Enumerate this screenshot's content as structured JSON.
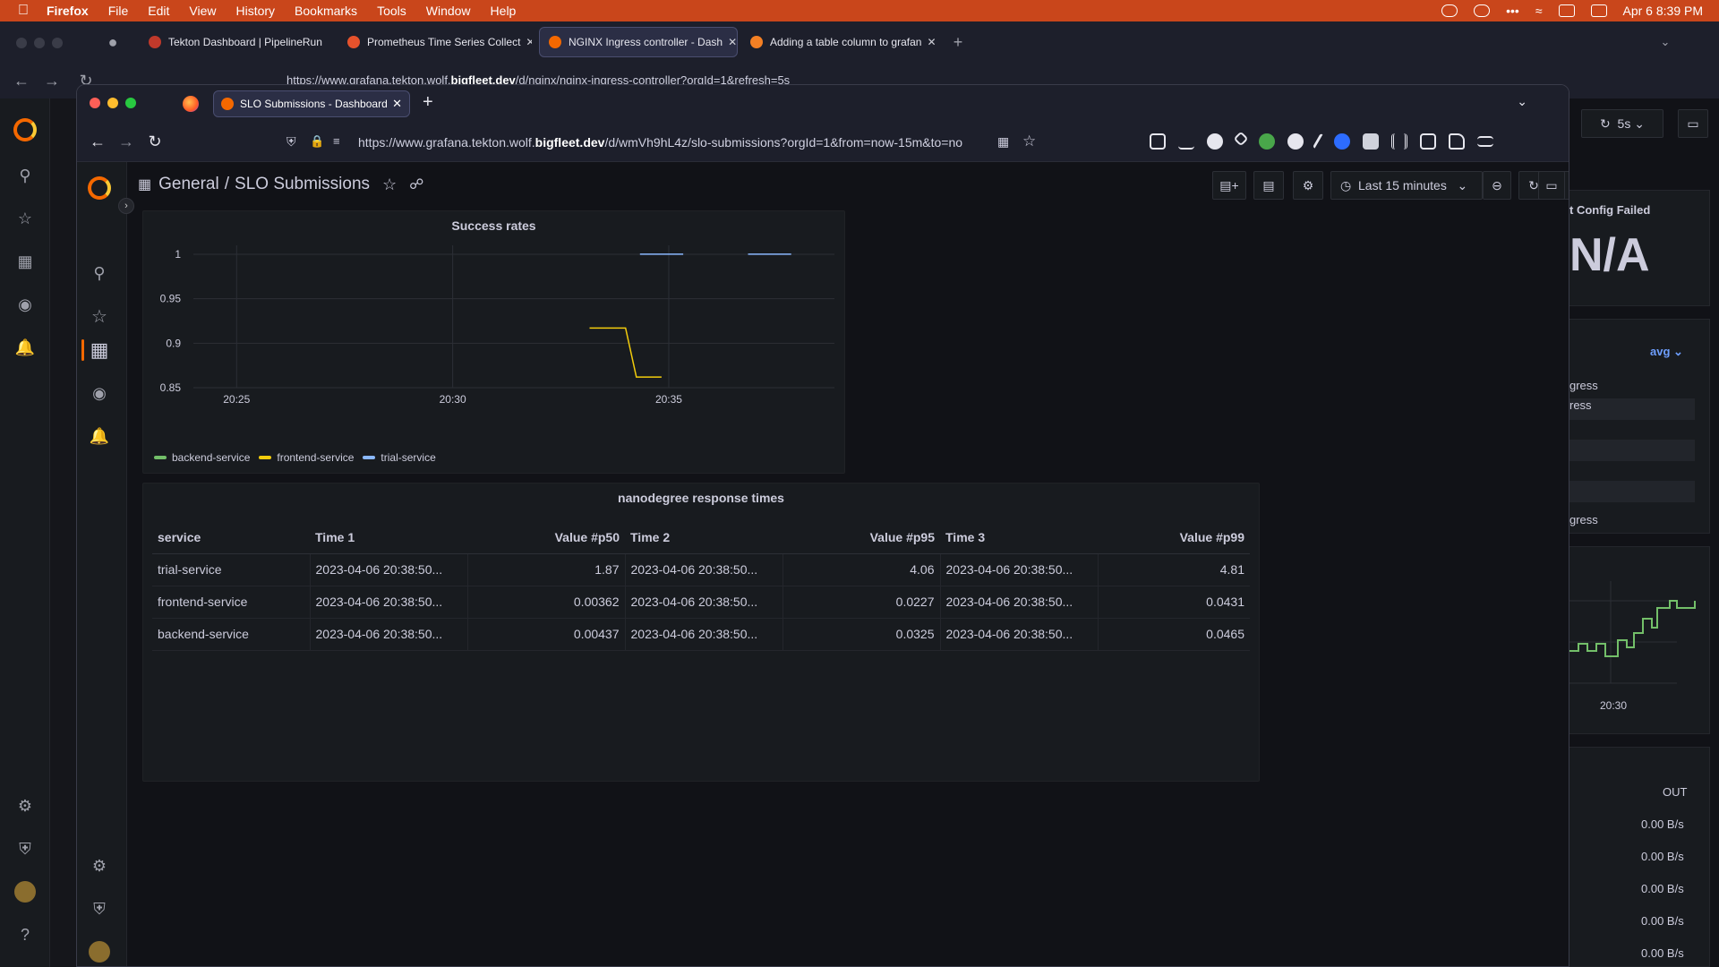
{
  "menubar": {
    "app": "Firefox",
    "items": [
      "File",
      "Edit",
      "View",
      "History",
      "Bookmarks",
      "Tools",
      "Window",
      "Help"
    ],
    "datetime": "Apr 6  8:39 PM"
  },
  "bg_window": {
    "tabs": [
      {
        "label": "Tekton Dashboard | PipelineRun"
      },
      {
        "label": "Prometheus Time Series Collect"
      },
      {
        "label": "NGINX Ingress controller - Dash"
      },
      {
        "label": "Adding a table column to grafan"
      }
    ],
    "url_prefix": "https://www.grafana.tekton.wolf.",
    "url_domain": "bigfleet.dev",
    "url_suffix": "/d/nginx/nginx-ingress-controller?orgId=1&refresh=5s",
    "refresh_interval": "5s",
    "stat_title": "t Config Failed",
    "stat_value": "N/A",
    "avg_label": "avg",
    "row_labels": [
      "gress",
      "ress",
      "gress"
    ],
    "chart_tick": "20:30",
    "out_header": "OUT",
    "out_values": [
      "0.00 B/s",
      "0.00 B/s",
      "0.00 B/s",
      "0.00 B/s",
      "0.00 B/s"
    ]
  },
  "window": {
    "tab_title": "SLO Submissions - Dashboards",
    "url_prefix": "https://www.grafana.tekton.wolf.",
    "url_domain": "bigfleet.dev",
    "url_suffix": "/d/wmVh9hL4z/slo-submissions?orgId=1&from=now-15m&to=no"
  },
  "dashboard": {
    "folder": "General",
    "title": "SLO Submissions",
    "time_range": "Last 15 minutes"
  },
  "chart_data": {
    "type": "line",
    "title": "Success rates",
    "xlabel": "",
    "ylabel": "",
    "x_ticks": [
      "20:25",
      "20:30",
      "20:35"
    ],
    "y_ticks": [
      "0.85",
      "0.9",
      "0.95",
      "1"
    ],
    "ylim": [
      0.85,
      1.01
    ],
    "grid": true,
    "legend": "bottom-left",
    "series": [
      {
        "name": "backend-service",
        "color": "#73bf69",
        "segments": []
      },
      {
        "name": "frontend-service",
        "color": "#f2cc0c",
        "segments": [
          [
            [
              "20:33:10",
              0.917
            ],
            [
              "20:34:00",
              0.917
            ],
            [
              "20:34:15",
              0.862
            ],
            [
              "20:34:50",
              0.862
            ]
          ]
        ]
      },
      {
        "name": "trial-service",
        "color": "#8ab8ff",
        "segments": [
          [
            [
              "20:34:20",
              1.0
            ],
            [
              "20:35:20",
              1.0
            ]
          ],
          [
            [
              "20:36:50",
              1.0
            ],
            [
              "20:37:50",
              1.0
            ]
          ]
        ]
      }
    ]
  },
  "table_panel": {
    "title": "nanodegree response times",
    "columns": [
      "service",
      "Time 1",
      "Value #p50",
      "Time 2",
      "Value #p95",
      "Time 3",
      "Value #p99"
    ],
    "rows": [
      [
        "trial-service",
        "2023-04-06 20:38:50...",
        "1.87",
        "2023-04-06 20:38:50...",
        "4.06",
        "2023-04-06 20:38:50...",
        "4.81"
      ],
      [
        "frontend-service",
        "2023-04-06 20:38:50...",
        "0.00362",
        "2023-04-06 20:38:50...",
        "0.0227",
        "2023-04-06 20:38:50...",
        "0.0431"
      ],
      [
        "backend-service",
        "2023-04-06 20:38:50...",
        "0.00437",
        "2023-04-06 20:38:50...",
        "0.0325",
        "2023-04-06 20:38:50...",
        "0.0465"
      ]
    ]
  }
}
